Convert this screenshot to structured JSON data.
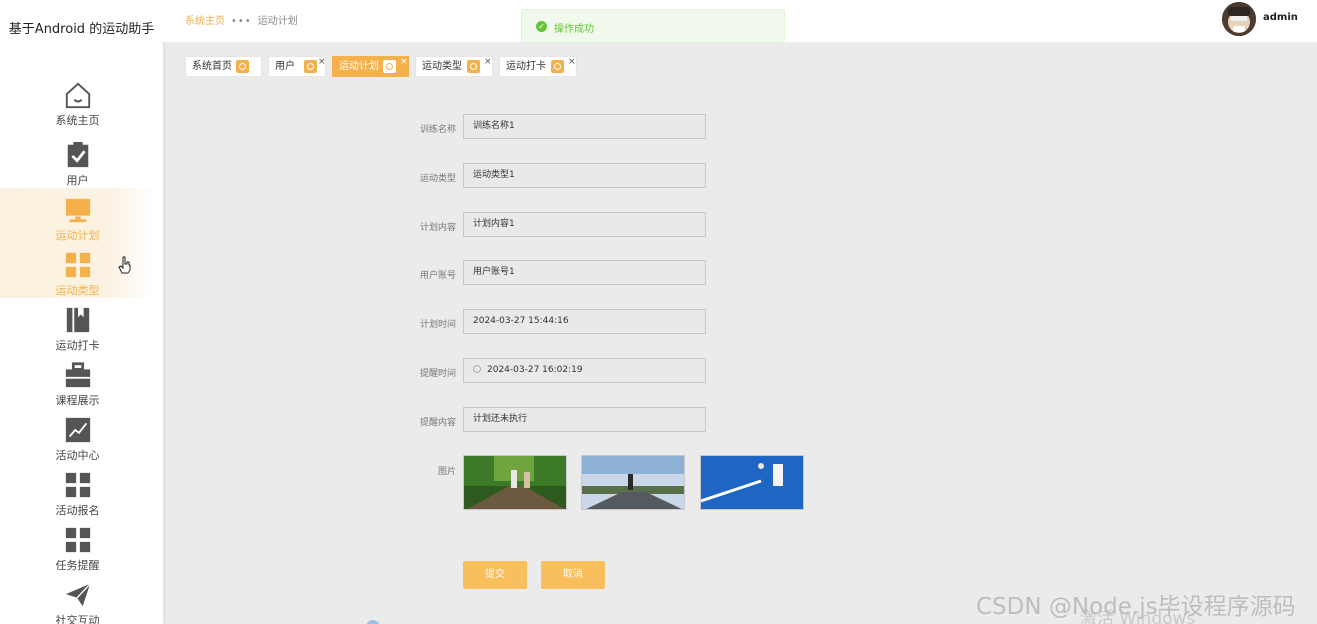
{
  "app": {
    "title": "基于Android 的运动助手"
  },
  "sidebar": {
    "items": [
      {
        "label": "系统主页",
        "icon": "home-icon",
        "active": false
      },
      {
        "label": "用户",
        "icon": "clipboard-check-icon",
        "active": false
      },
      {
        "label": "运动计划",
        "icon": "monitor-icon",
        "active": true
      },
      {
        "label": "运动类型",
        "icon": "grid-icon",
        "active": true
      },
      {
        "label": "运动打卡",
        "icon": "book-icon",
        "active": false
      },
      {
        "label": "课程展示",
        "icon": "briefcase-icon",
        "active": false
      },
      {
        "label": "活动中心",
        "icon": "trend-chart-icon",
        "active": false
      },
      {
        "label": "活动报名",
        "icon": "grid-icon",
        "active": false
      },
      {
        "label": "任务提醒",
        "icon": "grid-icon",
        "active": false
      },
      {
        "label": "社交互动",
        "icon": "paper-plane-icon",
        "active": false
      }
    ]
  },
  "header": {
    "breadcrumb": {
      "home": "系统主页",
      "current": "运动计划"
    },
    "toast": {
      "text": "操作成功"
    },
    "user": {
      "name": "admin"
    }
  },
  "tabs": [
    {
      "label": "系统首页",
      "active": false,
      "closable": false
    },
    {
      "label": "用户",
      "active": false,
      "closable": true
    },
    {
      "label": "运动计划",
      "active": true,
      "closable": true
    },
    {
      "label": "运动类型",
      "active": false,
      "closable": true
    },
    {
      "label": "运动打卡",
      "active": false,
      "closable": true
    }
  ],
  "form": {
    "fields": [
      {
        "label": "训练名称",
        "value": "训练名称1"
      },
      {
        "label": "运动类型",
        "value": "运动类型1"
      },
      {
        "label": "计划内容",
        "value": "计划内容1"
      },
      {
        "label": "用户账号",
        "value": "用户账号1"
      },
      {
        "label": "计划时间",
        "value": "2024-03-27 15:44:16"
      },
      {
        "label": "提醒时间",
        "value": "2024-03-27 16:02:19"
      },
      {
        "label": "提醒内容",
        "value": "计划还未执行"
      }
    ],
    "image_label": "图片",
    "submit_label": "提交",
    "cancel_label": "取消"
  },
  "overlay": {
    "watermark": "CSDN @Node.js毕设程序源码",
    "activate_windows": "激活 Windows"
  },
  "colors": {
    "accent": "#f4b04a",
    "success": "#67c23a",
    "background": "#ebebeb"
  }
}
